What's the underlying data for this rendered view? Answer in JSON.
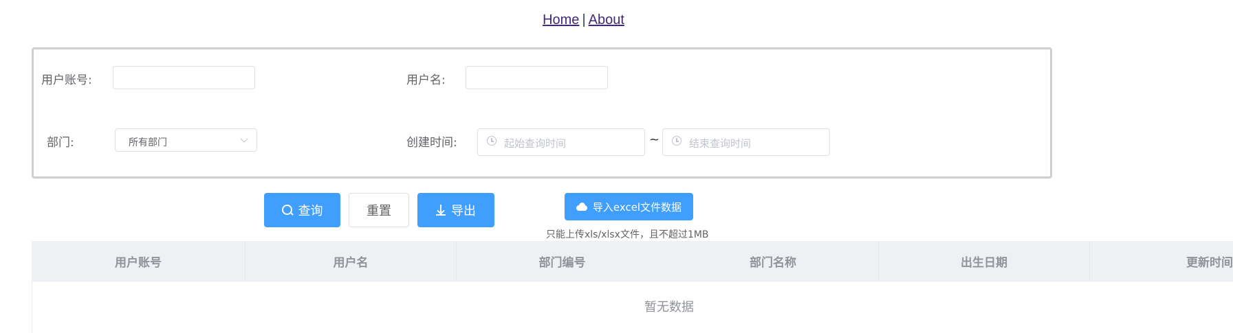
{
  "nav": {
    "home": "Home",
    "separator": "|",
    "about": "About"
  },
  "form": {
    "account_label": "用户账号:",
    "account_value": "",
    "username_label": "用户名:",
    "username_value": "",
    "dept_label": "部门:",
    "dept_selected": "所有部门",
    "created_label": "创建时间:",
    "start_placeholder": "起始查询时间",
    "range_separator": "~",
    "end_placeholder": "结束查询时间"
  },
  "actions": {
    "search_label": "查询",
    "reset_label": "重置",
    "export_label": "导出",
    "import_label": "导入excel文件数据",
    "upload_tip": "只能上传xls/xlsx文件，且不超过1MB"
  },
  "icons": {
    "search": "search-icon",
    "export": "download-icon",
    "import": "upload-cloud-icon",
    "date": "clock-icon",
    "select": "chevron-down-icon"
  },
  "colors": {
    "primary": "#409eff",
    "header_bg": "#eff0f3",
    "muted": "#909399"
  },
  "table": {
    "columns": [
      "用户账号",
      "用户名",
      "部门编号",
      "部门名称",
      "出生日期",
      "更新时间"
    ],
    "empty_text": "暂无数据"
  }
}
